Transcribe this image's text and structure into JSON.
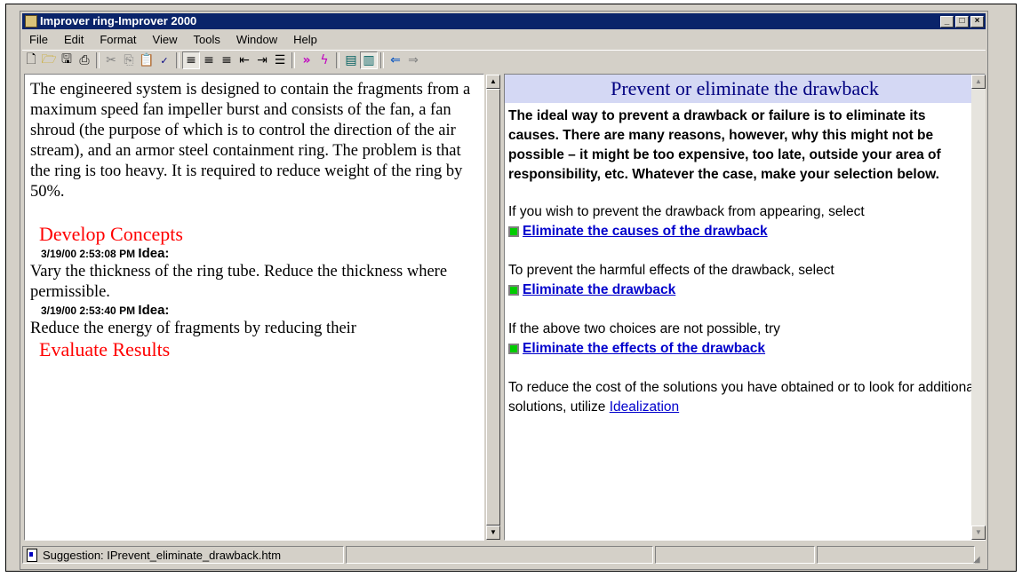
{
  "window": {
    "title": "Improver ring-Improver 2000"
  },
  "menu": [
    "File",
    "Edit",
    "Format",
    "View",
    "Tools",
    "Window",
    "Help"
  ],
  "left": {
    "problem": "The engineered system is designed to contain the fragments from a maximum speed fan impeller burst and consists of the fan, a fan shroud (the purpose of which is to control the direction of the air stream), and an armor steel containment ring. The problem is that the ring is too heavy.  It is required to reduce weight of the ring by 50%.",
    "section1": "Develop Concepts",
    "ideas": [
      {
        "timestamp": "3/19/00 2:53:08 PM",
        "label": "Idea:",
        "text": "Vary the thickness of the ring tube.  Reduce the thickness where permissible."
      },
      {
        "timestamp": "3/19/00 2:53:40 PM",
        "label": "Idea:",
        "text": "Reduce the energy of fragments by reducing their"
      }
    ],
    "section2": "Evaluate Results"
  },
  "right": {
    "heading": "Prevent or eliminate the drawback",
    "intro": "The ideal way to prevent a drawback or failure is to eliminate its causes. There are many reasons, however, why this might not be possible – it might be too expensive, too late, outside your area of responsibility, etc. Whatever the case, make your selection below.",
    "p1": "If you wish to prevent the drawback from appearing, select",
    "link1": "Eliminate the causes of the drawback",
    "p2": "To prevent the harmful effects of the drawback, select",
    "link2": "Eliminate the drawback",
    "p3": "If the above two choices are not possible, try",
    "link3": "Eliminate the effects of the drawback",
    "p4": "To reduce the cost of the solutions you have obtained or to look for additional solutions, utilize",
    "link4": "Idealization"
  },
  "status": {
    "text": "Suggestion: IPrevent_eliminate_drawback.htm"
  },
  "icons": [
    "new-icon",
    "open-icon",
    "save-icon",
    "print-icon",
    "cut-icon",
    "copy-icon",
    "paste-icon",
    "spellcheck-icon",
    "align-left-icon",
    "align-center-icon",
    "align-right-icon",
    "outdent-icon",
    "indent-icon",
    "bullets-icon",
    "forward-icon",
    "lightning-icon",
    "view-left-icon",
    "view-right-icon",
    "back-arrow-icon",
    "forward-arrow-icon"
  ]
}
